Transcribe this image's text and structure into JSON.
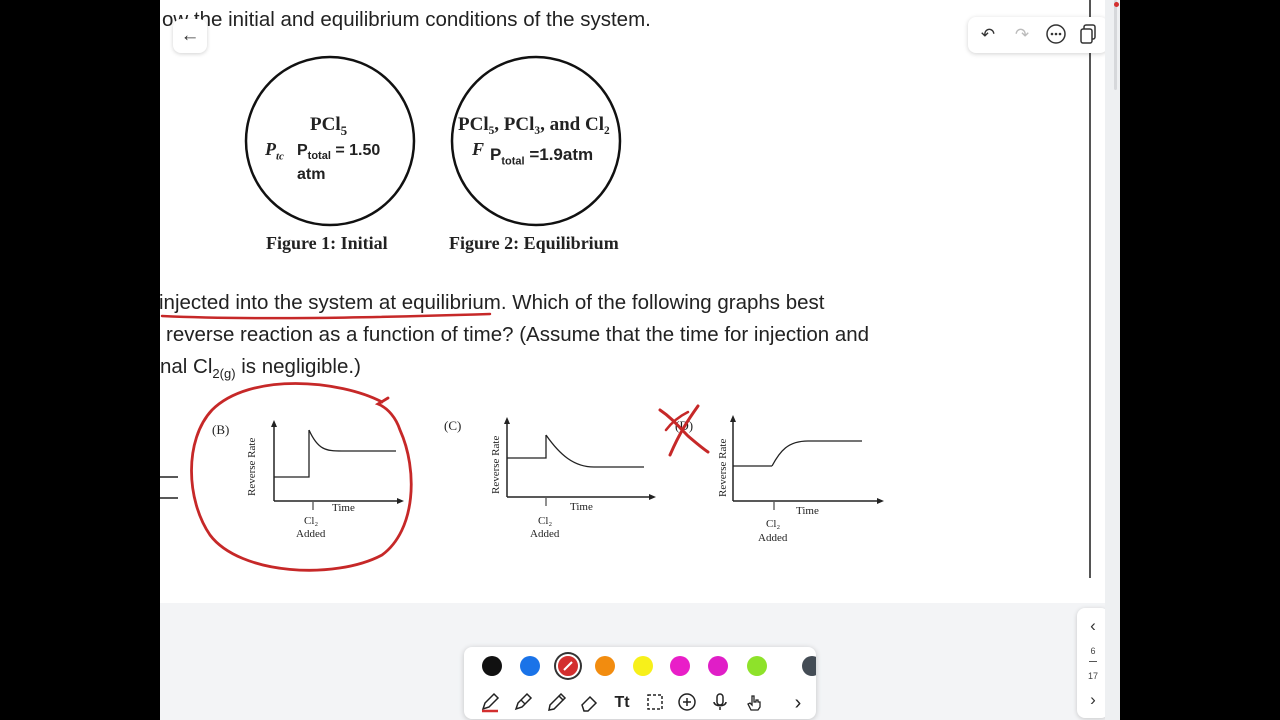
{
  "document": {
    "line1": "ow the initial and equilibrium conditions of the system.",
    "fig1": {
      "species": "PCl",
      "sub": "5",
      "p_frag": "P",
      "p_frag_sub": "tc",
      "p_label": "P",
      "p_sub": "total",
      "p_value": "= 1.50",
      "p_unit": "atm",
      "caption": "Figure 1: Initial"
    },
    "fig2": {
      "species": "PCl₅, PCl₃, and Cl₂",
      "p_frag": "F",
      "p_label": "P",
      "p_sub": "total",
      "p_value": "=1.9atm",
      "caption": "Figure 2: Equilibrium"
    },
    "para_line1_u": "injected into the system at equilibrium",
    "para_line1_rest": ". Which of the following graphs best",
    "para_line2": "reverse reaction as a function of time? (Assume that the time for injection and",
    "para_line3_a": "nal Cl",
    "para_line3_sub": "2(g)",
    "para_line3_b": " is negligible.)",
    "graphs": [
      {
        "letter": "(B)",
        "ylabel": "Reverse Rate",
        "xlabel": "Time",
        "added1": "Cl₂",
        "added2": "Added"
      },
      {
        "letter": "(C)",
        "ylabel": "Reverse Rate",
        "xlabel": "Time",
        "added1": "Cl₂",
        "added2": "Added"
      },
      {
        "letter": "(D)",
        "ylabel": "Reverse Rate",
        "xlabel": "Time",
        "added1": "Cl₂",
        "added2": "Added"
      }
    ]
  },
  "nav": {
    "back_icon": "arrow-left-icon"
  },
  "top_tools": [
    "undo-icon",
    "redo-icon",
    "more-icon",
    "pages-icon"
  ],
  "pager": {
    "current": "6",
    "total": "17"
  },
  "pen_colors": [
    "#111111",
    "#1a73e8",
    "#d32f2f",
    "#f28c0f",
    "#f7f01a",
    "#e91ec8",
    "#e01ec7",
    "#8ee22a",
    "#444c55"
  ],
  "tools": [
    "pen-icon",
    "highlighter-icon",
    "marker-icon",
    "eraser-icon",
    "text-icon",
    "lasso-icon",
    "add-icon",
    "microphone-icon",
    "touch-icon",
    "chevron-right-icon"
  ],
  "annotations": {
    "ink_color": "#c62828"
  }
}
